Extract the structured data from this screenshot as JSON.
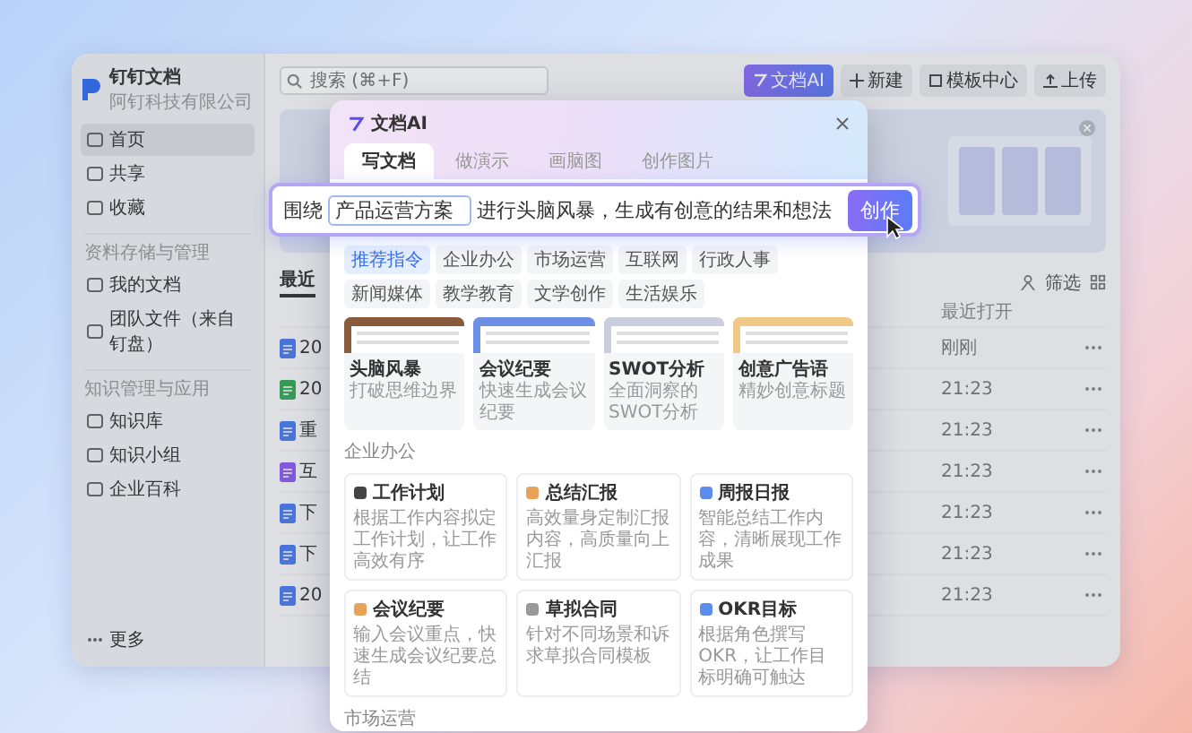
{
  "app": {
    "logo_title": "钉钉文档",
    "logo_subtitle": "阿钉科技有限公司"
  },
  "sidebar": {
    "nav": [
      {
        "kind": "item",
        "label": "首页",
        "selected": true
      },
      {
        "kind": "item",
        "label": "共享",
        "selected": false
      },
      {
        "kind": "item",
        "label": "收藏",
        "selected": false
      },
      {
        "kind": "heading",
        "label": "资料存储与管理"
      },
      {
        "kind": "item",
        "label": "我的文档",
        "selected": false
      },
      {
        "kind": "item",
        "label": "团队文件（来自钉盘）",
        "selected": false
      },
      {
        "kind": "heading",
        "label": "知识管理与应用"
      },
      {
        "kind": "item",
        "label": "知识库",
        "selected": false
      },
      {
        "kind": "item",
        "label": "知识小组",
        "selected": false
      },
      {
        "kind": "item",
        "label": "企业百科",
        "selected": false
      }
    ],
    "more": "更多"
  },
  "topbar": {
    "search": {
      "placeholder": "搜索 (⌘+F)"
    },
    "buttons": [
      {
        "kind": "ai",
        "label": "文档AI"
      },
      {
        "kind": "new",
        "label": "新建"
      },
      {
        "kind": "template",
        "label": "模板中心"
      },
      {
        "kind": "upload",
        "label": "上传"
      }
    ]
  },
  "files": {
    "tab": "最近",
    "filter": "筛选",
    "column": "最近打开",
    "rows": [
      {
        "kind": "doc",
        "name": "20",
        "time": "刚刚"
      },
      {
        "kind": "sheet",
        "name": "20",
        "time": "21:23"
      },
      {
        "kind": "doc",
        "name": "重",
        "time": "21:23"
      },
      {
        "kind": "mind",
        "name": "互",
        "time": "21:23"
      },
      {
        "kind": "doc",
        "name": "下",
        "time": "21:23"
      },
      {
        "kind": "doc",
        "name": "下",
        "time": "21:23"
      },
      {
        "kind": "doc",
        "name": "20",
        "time": "21:23"
      }
    ]
  },
  "modal": {
    "title": "文档AI",
    "tabs": [
      {
        "label": "写文档",
        "selected": true
      },
      {
        "label": "做演示",
        "selected": false
      },
      {
        "label": "画脑图",
        "selected": false
      },
      {
        "label": "创作图片",
        "selected": false
      }
    ],
    "prompt": {
      "prefix": "围绕",
      "value": "产品运营方案",
      "suffix": "进行头脑风暴，生成有创意的结果和想法",
      "submit": "创作"
    },
    "chips": [
      {
        "label": "推荐指令",
        "selected": true
      },
      {
        "label": "企业办公",
        "selected": false
      },
      {
        "label": "市场运营",
        "selected": false
      },
      {
        "label": "互联网",
        "selected": false
      },
      {
        "label": "行政人事",
        "selected": false
      },
      {
        "label": "新闻媒体",
        "selected": false
      },
      {
        "label": "教学教育",
        "selected": false
      },
      {
        "label": "文学创作",
        "selected": false
      },
      {
        "label": "生活娱乐",
        "selected": false
      }
    ],
    "templates": [
      {
        "title": "头脑风暴",
        "desc": "打破思维边界"
      },
      {
        "title": "会议纪要",
        "desc": "快速生成会议纪要"
      },
      {
        "title": "SWOT分析",
        "desc": "全面洞察的SWOT分析"
      },
      {
        "title": "创意广告语",
        "desc": "精妙创意标题"
      }
    ],
    "sections": [
      {
        "title": "企业办公",
        "cards": [
          {
            "title": "工作计划",
            "desc": "根据工作内容拟定工作计划，让工作高效有序"
          },
          {
            "title": "总结汇报",
            "desc": "高效量身定制汇报内容，高质量向上汇报"
          },
          {
            "title": "周报日报",
            "desc": "智能总结工作内容，清晰展现工作成果"
          },
          {
            "title": "会议纪要",
            "desc": "输入会议重点，快速生成会议纪要总结"
          },
          {
            "title": "草拟合同",
            "desc": "针对不同场景和诉求草拟合同模板"
          },
          {
            "title": "OKR目标",
            "desc": "根据角色撰写OKR，让工作目标明确可触达"
          }
        ]
      },
      {
        "title": "市场运营"
      }
    ]
  }
}
